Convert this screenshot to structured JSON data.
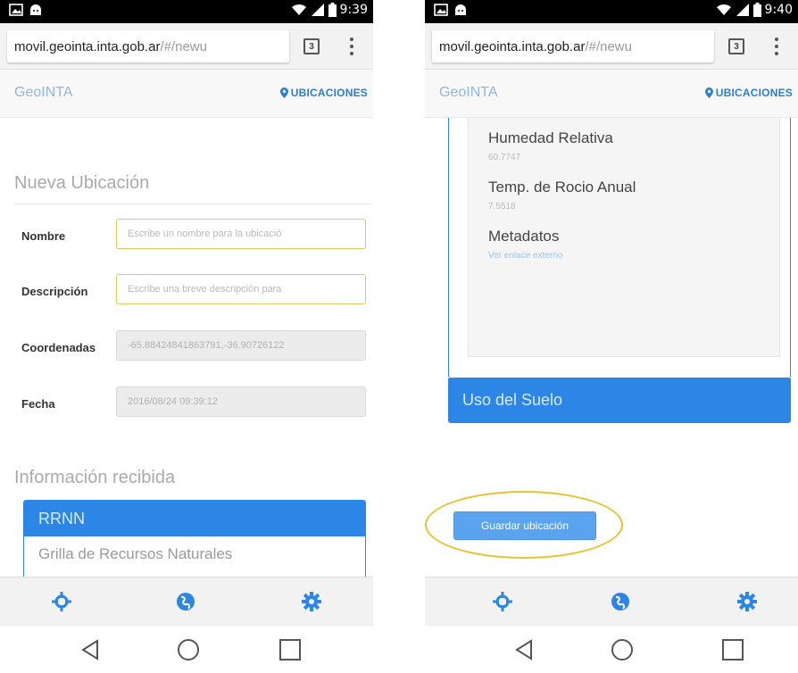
{
  "left_screen": {
    "status_bar": {
      "time": "9:39"
    },
    "browser": {
      "url_host": "movil.geointa.inta.gob.ar",
      "url_path": "/#/newu",
      "tab_count": "3"
    },
    "navbar": {
      "brand": "GeoINTA",
      "nav_link": "UBICACIONES"
    },
    "form": {
      "title": "Nueva Ubicación",
      "fields": [
        {
          "label": "Nombre",
          "placeholder": "Escribe un nombre para la ubicació"
        },
        {
          "label": "Descripción",
          "placeholder": "Escribe una breve descripción para"
        },
        {
          "label": "Coordenadas",
          "value": "-65.88424841863791,-36.90726122"
        },
        {
          "label": "Fecha",
          "value": "2016/08/24 09:39:12"
        }
      ]
    },
    "info": {
      "title": "Información recibida",
      "panel_heading": "RRNN",
      "panel_item": "Grilla de Recursos Naturales"
    }
  },
  "right_screen": {
    "status_bar": {
      "time": "9:40"
    },
    "browser": {
      "url_host": "movil.geointa.inta.gob.ar",
      "url_path": "/#/newu",
      "tab_count": "3"
    },
    "navbar": {
      "brand": "GeoINTA",
      "nav_link": "UBICACIONES"
    },
    "attributes": [
      {
        "name": "Humedad Relativa",
        "value": "60.7747"
      },
      {
        "name": "Temp. de Rocio Anual",
        "value": "7.5518"
      },
      {
        "name": "Metadatos",
        "link": "Ver enlace externo"
      }
    ],
    "panel_heading": "Uso del Suelo",
    "save_button": "Guardar ubicación"
  },
  "colors": {
    "primary": "#2b86e6",
    "nav_link": "#2d7ecc",
    "highlight": "#e8c230",
    "input_border": "#e6c65c"
  },
  "icons": [
    "wifi-icon",
    "signal-icon",
    "battery-icon",
    "crosshair-icon",
    "globe-icon",
    "gear-icon",
    "back-icon",
    "home-icon",
    "recents-icon",
    "map-marker-icon"
  ]
}
